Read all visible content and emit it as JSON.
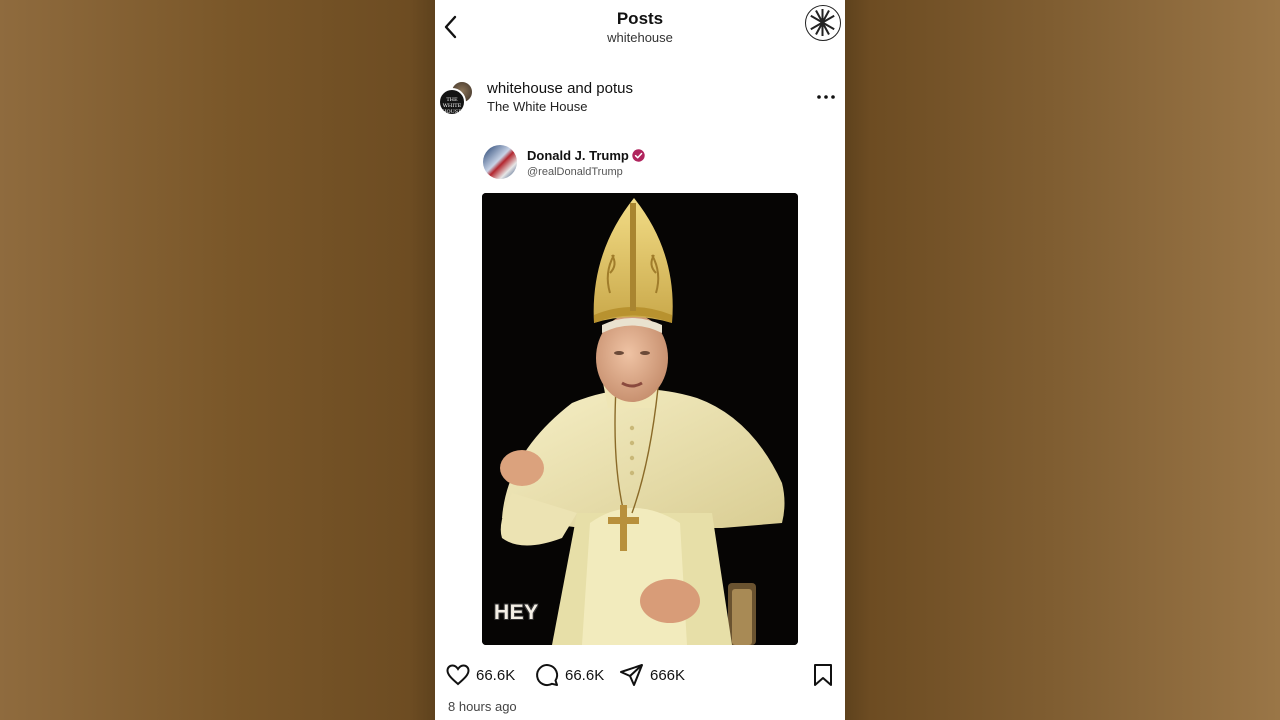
{
  "topbar": {
    "title": "Posts",
    "subtitle": "whitehouse",
    "back_icon": "chevron-left-icon",
    "account_icon": "profile-avatar-icon"
  },
  "post": {
    "author_primary": "whitehouse",
    "author_join": "and",
    "author_secondary": "potus",
    "subtitle": "The White House",
    "avatar_front_text": "THE WHITE HOUSE",
    "more_icon": "more-horizontal-icon"
  },
  "tweet": {
    "name": "Donald J. Trump",
    "handle": "@realDonaldTrump",
    "verified_color": "#b0245d",
    "image_caption": "HEY"
  },
  "actions": {
    "likes": "66.6K",
    "comments": "66.6K",
    "shares": "666K",
    "save_icon": "bookmark-icon"
  },
  "timestamp": "8 hours ago",
  "colors": {
    "background_accent": "#7a5729",
    "text_primary": "#111111"
  }
}
